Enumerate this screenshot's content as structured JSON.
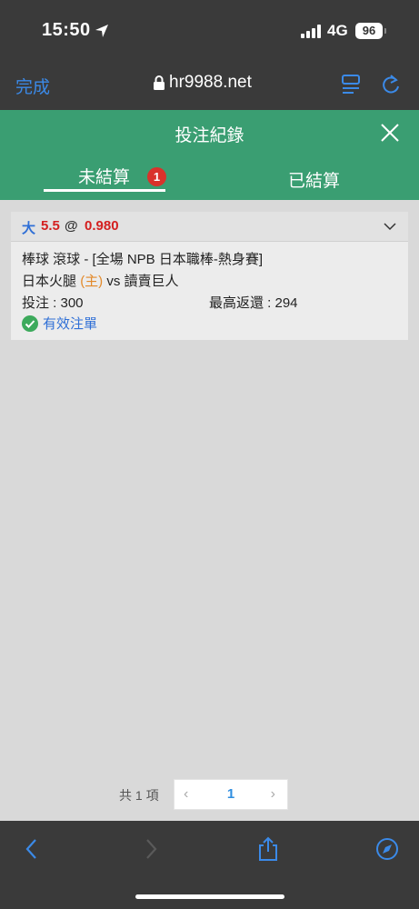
{
  "status_bar": {
    "time": "15:50",
    "network": "4G",
    "battery": "96"
  },
  "browser": {
    "done_label": "完成",
    "url": "hr9988.net"
  },
  "page": {
    "title": "投注紀錄"
  },
  "tabs": {
    "unsettled": "未結算",
    "unsettled_badge": "1",
    "settled": "已結算"
  },
  "bet": {
    "side": "大",
    "line": "5.5",
    "at": "@",
    "odds": "0.980",
    "league": "棒球 滾球 - [全場 NPB 日本職棒-熱身賽]",
    "home_team": "日本火腿",
    "home_tag": "(主)",
    "vs": "vs",
    "away_team": "讀賣巨人",
    "stake_label": "投注 : 300",
    "max_return_label": "最高返還 : 294",
    "status": "有效注單"
  },
  "pagination": {
    "total": "共 1 項",
    "prev": "‹",
    "page": "1",
    "next": "›"
  },
  "colors": {
    "header_green": "#3a9e72",
    "accent_blue": "#2f6fd6",
    "odds_red": "#d42020",
    "badge_red": "#d9322b"
  }
}
